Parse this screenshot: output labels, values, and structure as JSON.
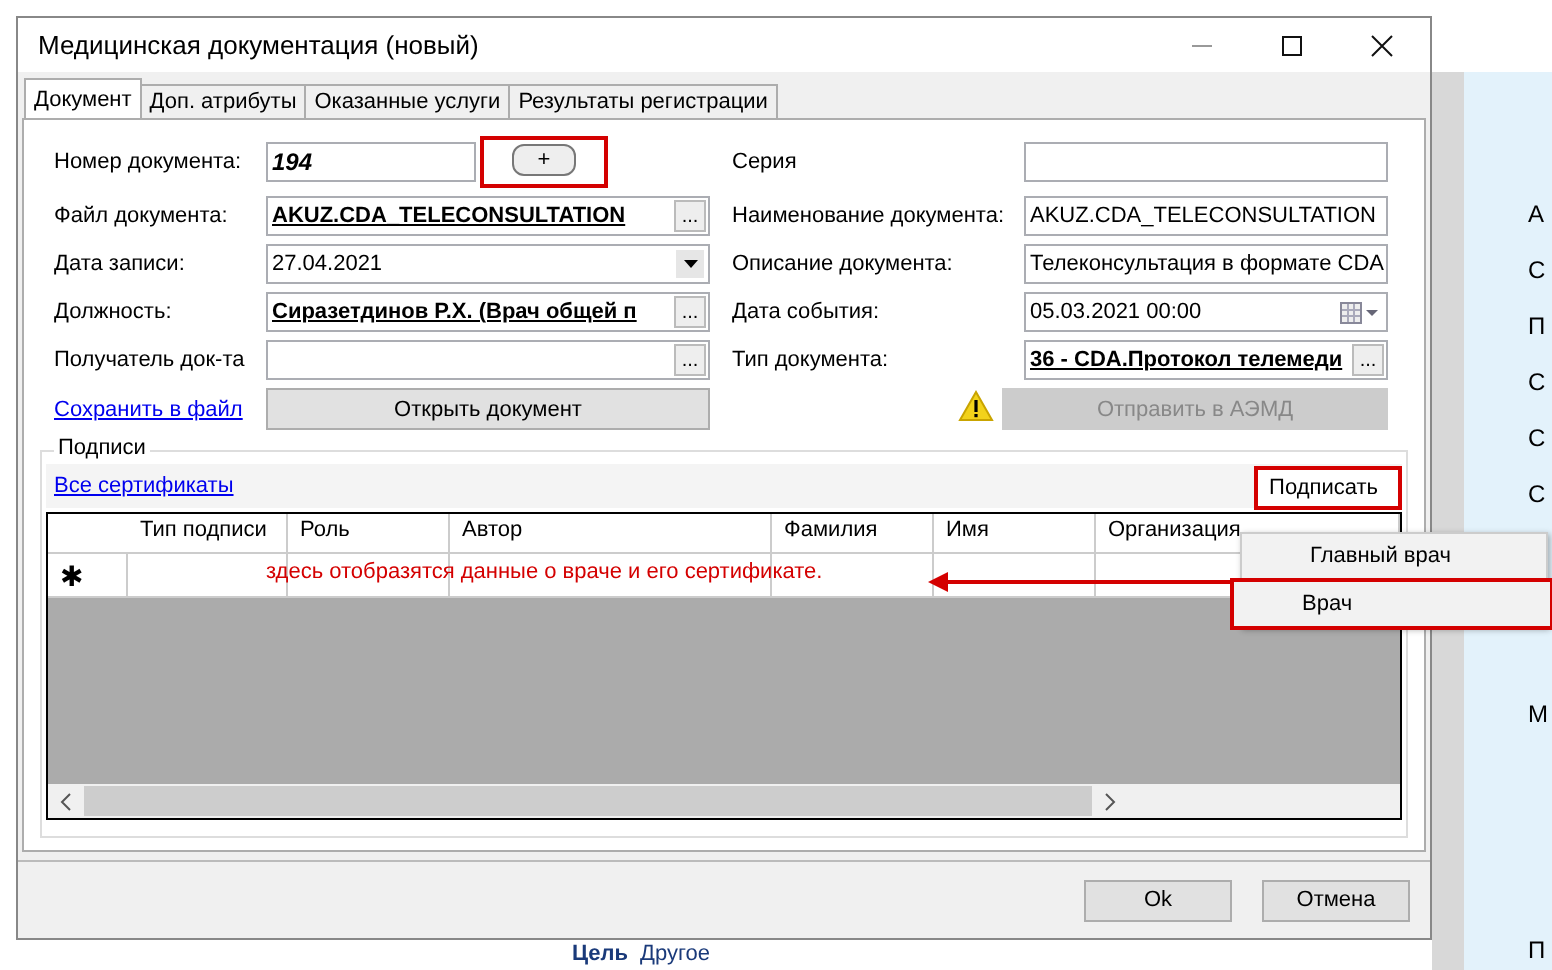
{
  "window": {
    "title": "Медицинская документация (новый)"
  },
  "tabs": [
    {
      "label": "Документ",
      "selected": true
    },
    {
      "label": "Доп. атрибуты",
      "selected": false
    },
    {
      "label": "Оказанные услуги",
      "selected": false
    },
    {
      "label": "Результаты регистрации",
      "selected": false
    }
  ],
  "fields_left": [
    {
      "label": "Номер документа:",
      "value": "194",
      "kind": "number",
      "add_button": "+"
    },
    {
      "label": "Файл документа:",
      "value": "AKUZ.CDA_TELECONSULTATION",
      "kind": "lookup"
    },
    {
      "label": "Дата записи:",
      "value": "27.04.2021",
      "kind": "dropdown"
    },
    {
      "label": "Должность:",
      "value": "Сиразетдинов Р.Х. (Врач общей п",
      "kind": "lookup"
    },
    {
      "label": "Получатель док-та",
      "kind": "lookup"
    }
  ],
  "fields_right": [
    {
      "label": "Серия",
      "kind": "text"
    },
    {
      "label": "Наименование документа:",
      "value": "AKUZ.CDA_TELECONSULTATION",
      "kind": "text"
    },
    {
      "label": "Описание документа:",
      "value": "Телеконсультация в формате CDA",
      "kind": "text"
    },
    {
      "label": "Дата события:",
      "value": "05.03.2021 00:00",
      "kind": "datetime"
    },
    {
      "label": "Тип документа:",
      "value": "36 - CDA.Протокол телемеди",
      "kind": "lookup"
    }
  ],
  "lookup_button": "...",
  "save_link": "Сохранить в файл",
  "open_button": "Открыть документ",
  "send_button": {
    "label": "Отправить в АЭМД",
    "disabled": true,
    "warning": true
  },
  "signatures": {
    "title": "Подписи",
    "certificates_link": "Все сертификаты",
    "sign_button": "Подписать",
    "columns": [
      "Тип подписи",
      "Роль",
      "Автор",
      "Фамилия",
      "Имя",
      "Организация"
    ],
    "new_row_marker": "✱",
    "note": "здесь отобразятся данные о враче и его сертификате.",
    "menu": [
      "Главный врач",
      "Врач"
    ]
  },
  "buttons": [
    "Ok",
    "Отмена"
  ],
  "background": {
    "side_letters": [
      "А",
      "С",
      "П",
      "С",
      "С",
      "С",
      "М",
      "П"
    ],
    "bottom_label": "Цель",
    "bottom_value": "Другое"
  }
}
